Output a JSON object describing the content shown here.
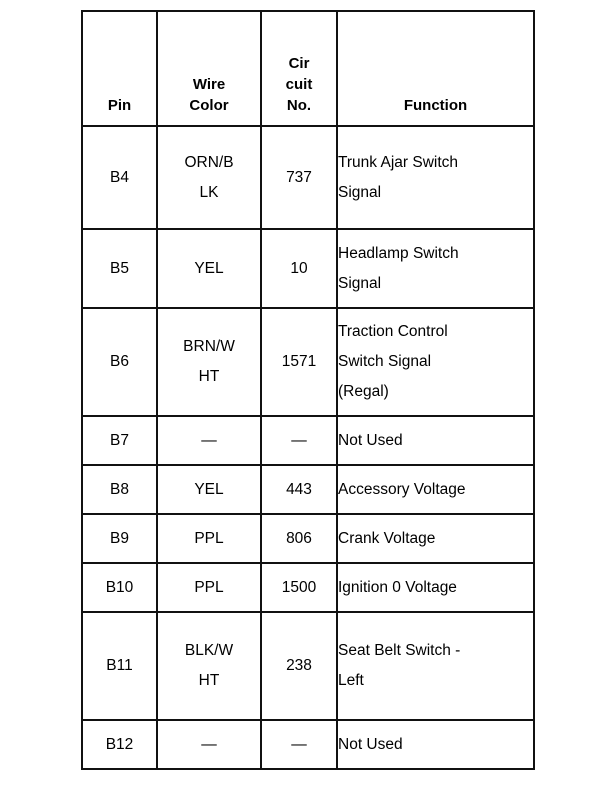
{
  "document": {
    "kind": "wiring-pinout-table",
    "background_color": "#ffffff",
    "line_color": "#111111"
  },
  "table": {
    "headers": {
      "pin": "Pin",
      "wire_color": "Wire\nColor",
      "circuit_no": "Cir\ncuit\nNo.",
      "function": "Function"
    },
    "rows": [
      {
        "pin": "B4",
        "wire_color": "ORN/B\nLK",
        "circuit_no": "737",
        "function": "Trunk Ajar Switch\nSignal",
        "lines": 3
      },
      {
        "pin": "B5",
        "wire_color": "YEL",
        "circuit_no": "10",
        "function": "Headlamp Switch\nSignal",
        "lines": 2
      },
      {
        "pin": "B6",
        "wire_color": "BRN/W\nHT",
        "circuit_no": "1571",
        "function": "Traction Control\nSwitch Signal\n(Regal)",
        "lines": 3
      },
      {
        "pin": "B7",
        "wire_color": "—",
        "circuit_no": "—",
        "function": "Not Used",
        "lines": 1
      },
      {
        "pin": "B8",
        "wire_color": "YEL",
        "circuit_no": "443",
        "function": "Accessory Voltage",
        "lines": 1
      },
      {
        "pin": "B9",
        "wire_color": "PPL",
        "circuit_no": "806",
        "function": "Crank Voltage",
        "lines": 1
      },
      {
        "pin": "B10",
        "wire_color": "PPL",
        "circuit_no": "1500",
        "function": "Ignition 0 Voltage",
        "lines": 1
      },
      {
        "pin": "B11",
        "wire_color": "BLK/W\nHT",
        "circuit_no": "238",
        "function": "Seat Belt Switch -\nLeft",
        "lines": 3
      },
      {
        "pin": "B12",
        "wire_color": "—",
        "circuit_no": "—",
        "function": "Not Used",
        "lines": 1
      }
    ]
  }
}
